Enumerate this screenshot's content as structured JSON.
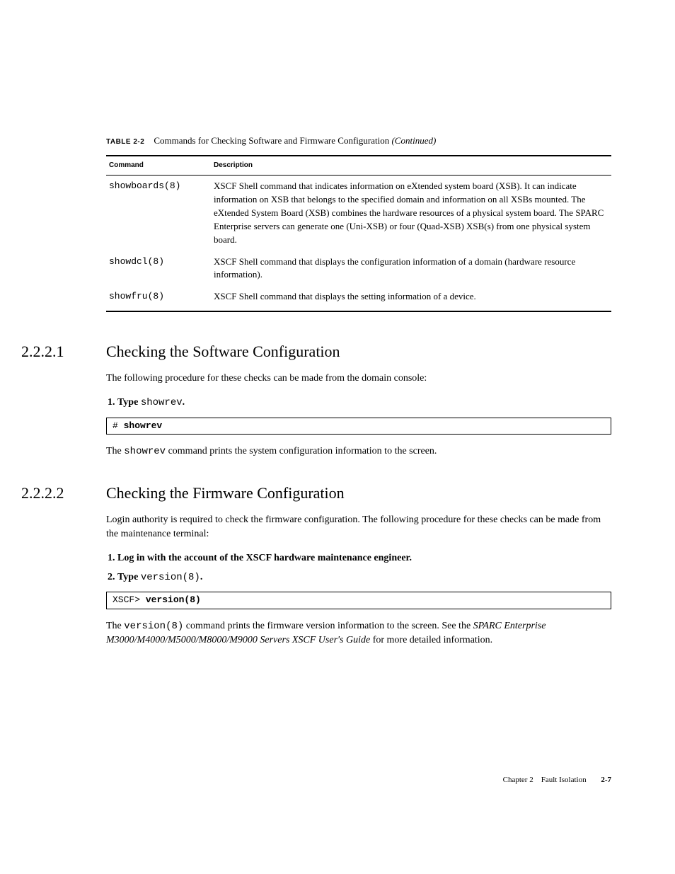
{
  "table": {
    "caption_label": "TABLE 2-2",
    "caption_text": "Commands for Checking Software and Firmware Configuration ",
    "caption_cont": "(Continued)",
    "header_command": "Command",
    "header_description": "Description",
    "rows": [
      {
        "command": "showboards(8)",
        "description": "XSCF Shell command that indicates information on eXtended system board (XSB). It can indicate information on XSB that belongs to the specified domain and information on all XSBs mounted. The eXtended System Board (XSB) combines the hardware resources of a physical system board. The SPARC Enterprise servers can generate one (Uni-XSB) or four (Quad-XSB) XSB(s) from one physical system board."
      },
      {
        "command": "showdcl(8)",
        "description": "XSCF Shell command that displays the configuration information of a domain (hardware resource information)."
      },
      {
        "command": "showfru(8)",
        "description": "XSCF Shell command that displays the setting information of a device."
      }
    ]
  },
  "section1": {
    "number": "2.2.2.1",
    "title": "Checking the Software Configuration",
    "intro": "The following procedure for these checks can be made from the domain console:",
    "step1_prefix": "Type ",
    "step1_cmd": "showrev",
    "step1_suffix": ".",
    "code_prompt": "# ",
    "code_cmd": "showrev",
    "after1": "The ",
    "after_cmd": "showrev",
    "after2": " command prints the system configuration information to the screen."
  },
  "section2": {
    "number": "2.2.2.2",
    "title": "Checking the Firmware Configuration",
    "intro": "Login authority is required to check the firmware configuration. The following procedure for these checks can be made from the maintenance terminal:",
    "step1": "Log in with the account of the XSCF hardware maintenance engineer.",
    "step2_prefix": "Type ",
    "step2_cmd": "version(8)",
    "step2_suffix": ".",
    "code_prompt": "XSCF> ",
    "code_cmd": "version(8)",
    "after1": "The ",
    "after_cmd": "version(8)",
    "after2": " command prints the firmware version information to the screen. See the ",
    "after_italic": "SPARC Enterprise M3000/M4000/M5000/M8000/M9000 Servers XSCF User's Guide",
    "after3": " for more detailed information."
  },
  "footer": {
    "chapter": "Chapter 2",
    "title": "Fault Isolation",
    "page": "2-7"
  }
}
